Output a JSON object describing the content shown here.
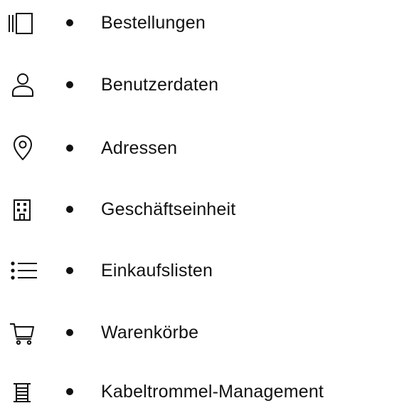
{
  "menu": {
    "items": [
      {
        "label": "Bestellungen",
        "icon": "orders-icon"
      },
      {
        "label": "Benutzerdaten",
        "icon": "user-icon"
      },
      {
        "label": "Adressen",
        "icon": "location-pin-icon"
      },
      {
        "label": "Geschäftseinheit",
        "icon": "building-icon"
      },
      {
        "label": "Einkaufslisten",
        "icon": "list-icon"
      },
      {
        "label": "Warenkörbe",
        "icon": "cart-icon"
      },
      {
        "label": "Kabeltrommel-Management",
        "icon": "cable-drum-icon"
      }
    ]
  }
}
